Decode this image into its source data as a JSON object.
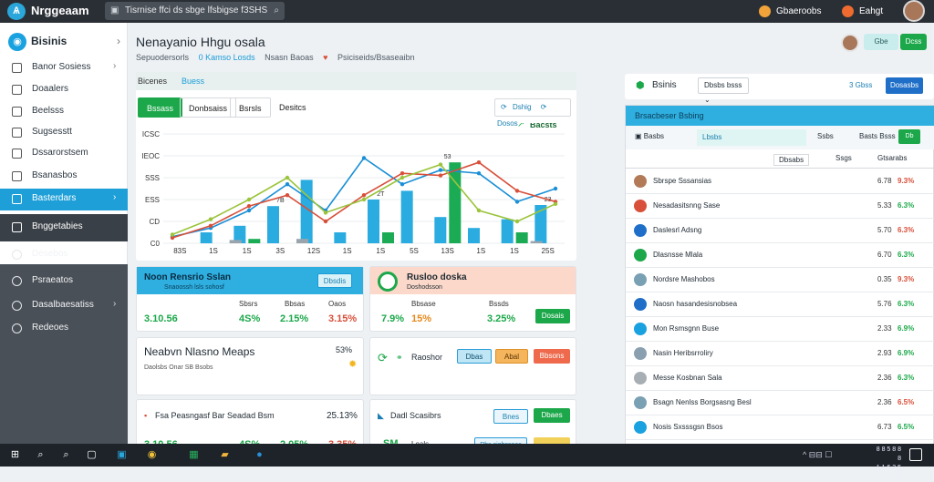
{
  "titlebar": {
    "app_name": "Nrggeaam",
    "address": "Tisrnise ffci ds sbge lfsbigse f3SHS",
    "user1": "Gbaeroobs",
    "user2": "Eahgt"
  },
  "sidebar": {
    "brand": "Bisinis",
    "items": [
      {
        "label": "Banor Sosiess",
        "chevron": true
      },
      {
        "label": "Doaalers",
        "chevron": false
      },
      {
        "label": "Beelsss",
        "chevron": false
      },
      {
        "label": "Sugsesstt",
        "chevron": false
      },
      {
        "label": "Dssarorstsem",
        "chevron": false
      },
      {
        "label": "Bsanasbos",
        "chevron": false
      },
      {
        "label": "Basterdars",
        "chevron": true,
        "state": "active"
      },
      {
        "label": "Bnggetabies",
        "chevron": false,
        "state": "dark"
      },
      {
        "label": "Desebos",
        "chevron": false
      },
      {
        "label": "Psraeatos",
        "chevron": false
      },
      {
        "label": "Dasalbaesatiss",
        "chevron": true
      },
      {
        "label": "Redeoes",
        "chevron": false
      }
    ]
  },
  "header": {
    "title": "Nenayanio Hhgu osala",
    "crumbs": [
      "Sepuodersorls",
      "0 Kamso Losds",
      "Nsasn Baoas",
      "Psiciseids/Bsaseaibn"
    ],
    "btn1": "Gbe",
    "btn2": "Dcss"
  },
  "left_panel": {
    "head1": "Bicenes",
    "head2": "Buess",
    "tabs": [
      "Bssass",
      "Donbsaiss",
      "Bsrsls",
      "Desitcs"
    ],
    "tools": [
      "Dshig",
      "Dosos"
    ]
  },
  "chart_data": {
    "type": "bar",
    "legend": "Bacsts",
    "y_ticks": [
      "ICSC",
      "IEOC",
      "SSS",
      "ESS",
      "CD",
      "C0"
    ],
    "categories": [
      "83S",
      "1S",
      "1S",
      "3S",
      "12S",
      "1S",
      "1S",
      "5S",
      "13S",
      "1S",
      "1S",
      "25S"
    ],
    "bar_labels": [
      "",
      "",
      "",
      "7B",
      "",
      "",
      "2T",
      "",
      "53",
      "",
      "",
      "23"
    ],
    "series": [
      {
        "values": [
          0,
          10,
          16,
          34,
          58,
          10,
          40,
          48,
          24,
          14,
          22,
          35
        ],
        "color": "#2aace0"
      },
      {
        "values": [
          0,
          0,
          4,
          0,
          0,
          0,
          10,
          0,
          74,
          0,
          10,
          0
        ],
        "color": "#1bab55"
      },
      {
        "values": [
          0,
          3,
          0,
          4,
          0,
          0,
          0,
          0,
          0,
          0,
          2,
          0
        ],
        "color": "#9aa4ad"
      }
    ],
    "lines": [
      {
        "points": [
          6,
          14,
          30,
          54,
          30,
          78,
          54,
          67,
          64,
          38,
          50
        ],
        "color": "#1a8fd6"
      },
      {
        "points": [
          5,
          16,
          34,
          44,
          20,
          44,
          64,
          62,
          74,
          48,
          38
        ],
        "color": "#d84f3a"
      },
      {
        "points": [
          8,
          22,
          40,
          60,
          28,
          40,
          60,
          72,
          30,
          20,
          36
        ],
        "color": "#9bc43b"
      }
    ],
    "ylim": [
      0,
      100
    ]
  },
  "cards": {
    "c1": {
      "title": "Noon Rensrio Sslan",
      "sub": "Snaoossh lsls sohosf",
      "btn": "Dbsdis",
      "vals": [
        "3.10.56",
        "4S%",
        "2.15%",
        "3.15%"
      ],
      "labels": [
        "Sbsrs",
        "Bbsas",
        "Lsss",
        "Oaos"
      ]
    },
    "c2": {
      "title": "Rusloo doska",
      "sub": "Doshodsson",
      "btn": "Dosais",
      "vals": [
        "7.9%",
        "15%",
        "3.25%"
      ],
      "labels": [
        "Bjsrs",
        "Bbsase",
        "Bssds"
      ]
    },
    "c3": {
      "title": "Neabvn Nlasno Meaps",
      "sub": "Daolsbs Onar SB Bsobs",
      "value": "53%"
    },
    "c4": {
      "title": "Raoshor",
      "btns": [
        "Dbas",
        "Abal",
        "Bbsons"
      ]
    },
    "c5": {
      "title": "Fsa Peasngasf Bar Seadad Bsm",
      "value": "25.13%",
      "vals": [
        "3.10.56",
        "4S%",
        "2.05%",
        "3.35%"
      ]
    },
    "c6": {
      "title": "Dadl Scasibrs",
      "btn": "Dbaes",
      "btn2": "Bnes",
      "foot": "SM",
      "foot2": "Loals",
      "tool": "Rbs sigbssaas"
    }
  },
  "right_panel": {
    "title": "Bsinis",
    "select": "Dbsbs bsss",
    "count": "3 Gbss",
    "btn": "Dosasbs",
    "table_title": "Brsacbeser Bsbing",
    "bar_left": "Basbs",
    "bar_mid": "Lbsbs",
    "bar_right": "Ssbs",
    "bar_right2": "Basts Bsss",
    "bar_btn": "Db",
    "cols": [
      "Dbsabs",
      "Ssgs",
      "Gtsarabs"
    ],
    "rows": [
      {
        "name": "Sbrspe Sssansias",
        "v1": "6.78",
        "v2": "9.3%",
        "color": "#d84f3a"
      },
      {
        "name": "Nesadasitsnng Sase",
        "v1": "5.33",
        "v2": "6.3%",
        "color": "#1ca84a"
      },
      {
        "name": "Daslesrl Adsng",
        "v1": "5.70",
        "v2": "6.3%",
        "color": "#d84f3a"
      },
      {
        "name": "Dlasnsse Mlala",
        "v1": "6.70",
        "v2": "6.3%",
        "color": "#1ca84a"
      },
      {
        "name": "Nordsre Mashobos",
        "v1": "0.35",
        "v2": "9.3%",
        "color": "#d84f3a"
      },
      {
        "name": "Naosn hasandesisnobsea",
        "v1": "5.76",
        "v2": "6.3%",
        "color": "#1ca84a"
      },
      {
        "name": "Mon Rsmsgnn Buse",
        "v1": "2.33",
        "v2": "6.9%",
        "color": "#1ca84a"
      },
      {
        "name": "Nasin Heribsrroliry",
        "v1": "2.93",
        "v2": "6.9%",
        "color": "#1ca84a"
      },
      {
        "name": "Messe Kosbnan Sala",
        "v1": "2.36",
        "v2": "6.3%",
        "color": "#1ca84a"
      },
      {
        "name": "Bsagn Nenlss Borgsasng Besl",
        "v1": "2.36",
        "v2": "6.5%",
        "color": "#d84f3a"
      },
      {
        "name": "Nosis Sxsssgsn Bsos",
        "v1": "6.73",
        "v2": "6.5%",
        "color": "#1ca84a"
      }
    ]
  },
  "taskbar": {
    "tray": "^  ⊟⊟  ☐",
    "time": "8 8 5 8 8 8",
    "date": "1 1 6 3 5 1"
  }
}
